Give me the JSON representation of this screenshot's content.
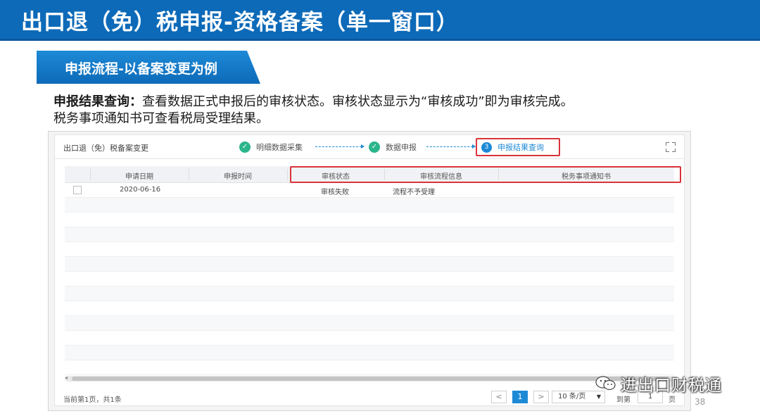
{
  "slide": {
    "title": "出口退（免）税申报-资格备案（单一窗口）",
    "section_label": "申报流程-以备案变更为例",
    "description_bold": "申报结果查询",
    "description_colon": "：",
    "description_line1": "查看数据正式申报后的审核状态。审核状态显示为“审核成功”即为审核完成。",
    "description_line2": "税务事项通知书可查看税局受理结果。",
    "page_number": "38"
  },
  "app": {
    "title": "出口退（免）税备案变更",
    "steps": [
      {
        "label": "明细数据采集",
        "state": "done"
      },
      {
        "label": "数据申报",
        "state": "done"
      },
      {
        "number": "3",
        "label": "申报结果查询",
        "state": "active"
      }
    ]
  },
  "table": {
    "headers": [
      "申请日期",
      "申报时间",
      "审核状态",
      "审核流程信息",
      "税务事项通知书"
    ],
    "rows": [
      {
        "date": "2020-06-16",
        "time": "",
        "status": "审核失败",
        "flow": "流程不予受理",
        "notice": ""
      }
    ]
  },
  "pagination": {
    "summary": "当前第1页，共1条",
    "prev": "<",
    "current": "1",
    "next": ">",
    "page_size": "10 条/页",
    "goto_label": "到第",
    "goto_value": "1",
    "goto_unit": "页"
  },
  "watermark": {
    "text": "进出口财税通"
  },
  "colors": {
    "title_bar": "#0d6ab8",
    "accent": "#1e8ad6",
    "done_step": "#2bb58b",
    "highlight_box": "#d9343a"
  }
}
